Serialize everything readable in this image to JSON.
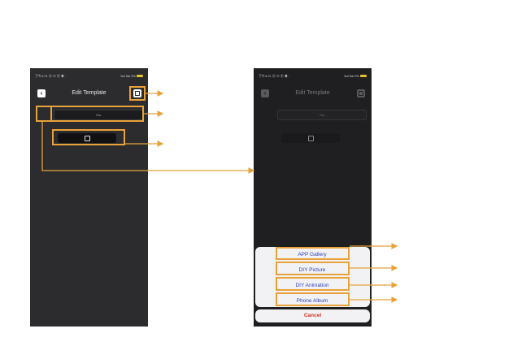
{
  "screen": {
    "title": "Edit Template",
    "name_placeholder": "Nia",
    "status_left": "下午4:21 ⓜ ☷ ▣ ◉ ·",
    "status_right": "5al 5al 9%"
  },
  "sheet": {
    "items": [
      "APP Gallery",
      "DIY Picture",
      "DIY Animation",
      "Phone Album"
    ],
    "cancel": "Cancel"
  },
  "colors": {
    "highlight": "#e8a23a",
    "sheet_text": "#2f3fb6",
    "cancel_text": "#d93025"
  }
}
